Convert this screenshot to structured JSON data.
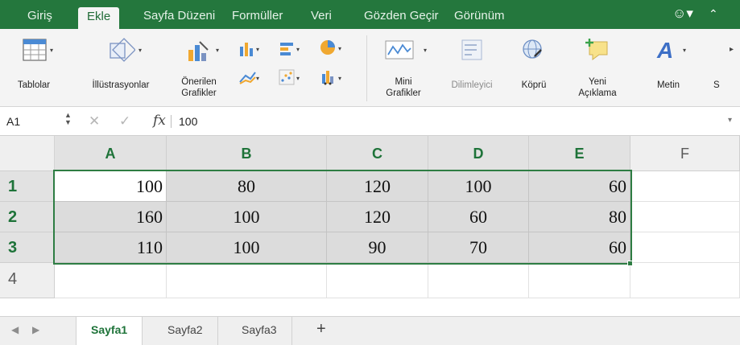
{
  "ribbon_tabs": [
    "Giriş",
    "Ekle",
    "Sayfa Düzeni",
    "Formüller",
    "Veri",
    "Gözden Geçir",
    "Görünüm"
  ],
  "active_tab": "Ekle",
  "ribbon": {
    "tables": "Tablolar",
    "illustrations": "İllüstrasyonlar",
    "recommended_charts_line1": "Önerilen",
    "recommended_charts_line2": "Grafikler",
    "sparklines_line1": "Mini",
    "sparklines_line2": "Grafikler",
    "slicer": "Dilimleyici",
    "link": "Köprü",
    "new_comment_line1": "Yeni",
    "new_comment_line2": "Açıklama",
    "text": "Metin",
    "cut_off": "S"
  },
  "formula_bar": {
    "name_box": "A1",
    "fx": "fx",
    "value": "100"
  },
  "columns": [
    "A",
    "B",
    "C",
    "D",
    "E",
    "F"
  ],
  "rows": [
    "1",
    "2",
    "3",
    "4"
  ],
  "cells": [
    [
      "100",
      "80",
      "120",
      "100",
      "60"
    ],
    [
      "160",
      "100",
      "120",
      "60",
      "80"
    ],
    [
      "110",
      "100",
      "90",
      "70",
      "60"
    ]
  ],
  "sheets": [
    "Sayfa1",
    "Sayfa2",
    "Sayfa3"
  ],
  "active_sheet": "Sayfa1",
  "colors": {
    "ribbon_green": "#24773d",
    "selection_border": "#2e7d43",
    "header_text_green": "#1e7339"
  }
}
